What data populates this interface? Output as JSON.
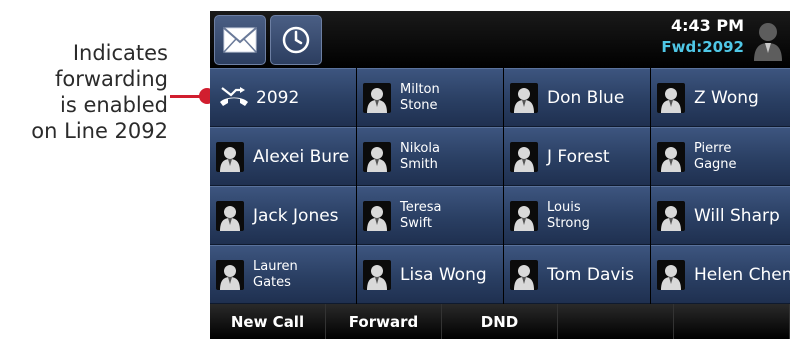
{
  "annotation": {
    "lines": [
      "Indicates",
      "forwarding",
      "is enabled",
      "on Line 2092"
    ],
    "callout_color": "#d11e2f"
  },
  "topbar": {
    "buttons": [
      {
        "icon": "envelope-icon"
      },
      {
        "icon": "clock-icon"
      }
    ],
    "time": "4:43 PM",
    "forward_status": "Fwd:2092",
    "user_icon": "user-avatar-icon"
  },
  "lines": [
    {
      "type": "line",
      "icon": "call-forward-icon",
      "name": [
        "2092"
      ]
    },
    {
      "type": "contact",
      "icon": "person-icon",
      "name": [
        "Milton",
        "Stone"
      ]
    },
    {
      "type": "contact",
      "icon": "person-icon",
      "name": [
        "Don Blue"
      ]
    },
    {
      "type": "contact",
      "icon": "person-icon",
      "name": [
        "Z Wong"
      ]
    },
    {
      "type": "contact",
      "icon": "person-icon",
      "name": [
        "Alexei Bure"
      ]
    },
    {
      "type": "contact",
      "icon": "person-icon",
      "name": [
        "Nikola",
        "Smith"
      ]
    },
    {
      "type": "contact",
      "icon": "person-icon",
      "name": [
        "J Forest"
      ]
    },
    {
      "type": "contact",
      "icon": "person-icon",
      "name": [
        "Pierre",
        "Gagne"
      ]
    },
    {
      "type": "contact",
      "icon": "person-icon",
      "name": [
        "Jack Jones"
      ]
    },
    {
      "type": "contact",
      "icon": "person-icon",
      "name": [
        "Teresa",
        "Swift"
      ]
    },
    {
      "type": "contact",
      "icon": "person-icon",
      "name": [
        "Louis",
        "Strong"
      ]
    },
    {
      "type": "contact",
      "icon": "person-icon",
      "name": [
        "Will Sharp"
      ]
    },
    {
      "type": "contact",
      "icon": "person-icon",
      "name": [
        "Lauren",
        "Gates"
      ]
    },
    {
      "type": "contact",
      "icon": "person-icon",
      "name": [
        "Lisa Wong"
      ]
    },
    {
      "type": "contact",
      "icon": "person-icon",
      "name": [
        "Tom Davis"
      ]
    },
    {
      "type": "contact",
      "icon": "person-icon",
      "name": [
        "Helen Chen"
      ]
    }
  ],
  "softkeys": [
    "New Call",
    "Forward",
    "DND",
    "",
    ""
  ],
  "colors": {
    "forward_status": "#4fc7e6",
    "cell_blue": "#2a3f63"
  }
}
